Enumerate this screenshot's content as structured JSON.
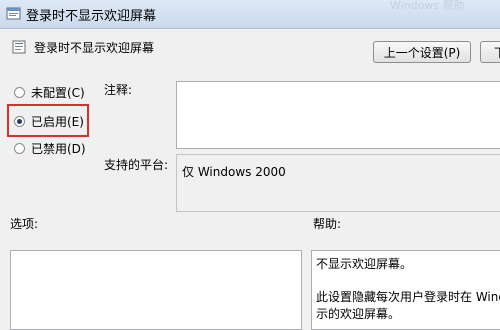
{
  "window": {
    "title": "登录时不显示欢迎屏幕",
    "ghost_text": "Windows 帮助"
  },
  "header": {
    "policy_title": "登录时不显示欢迎屏幕",
    "prev_button": "上一个设置(P)",
    "next_button": "下"
  },
  "radios": [
    {
      "label": "未配置(C)",
      "checked": false
    },
    {
      "label": "已启用(E)",
      "checked": true
    },
    {
      "label": "已禁用(D)",
      "checked": false
    }
  ],
  "fields": {
    "comment_label": "注释:",
    "platform_label": "支持的平台:",
    "platform_value": "仅 Windows 2000",
    "options_label": "选项:",
    "help_label": "帮助:"
  },
  "help": {
    "line1": "不显示欢迎屏幕。",
    "line2": "此设置隐藏每次用户登录时在 Wind",
    "line3": "示的欢迎屏幕。"
  },
  "colors": {
    "highlight": "#d9312f",
    "title_bar": "#dfe9f5"
  }
}
